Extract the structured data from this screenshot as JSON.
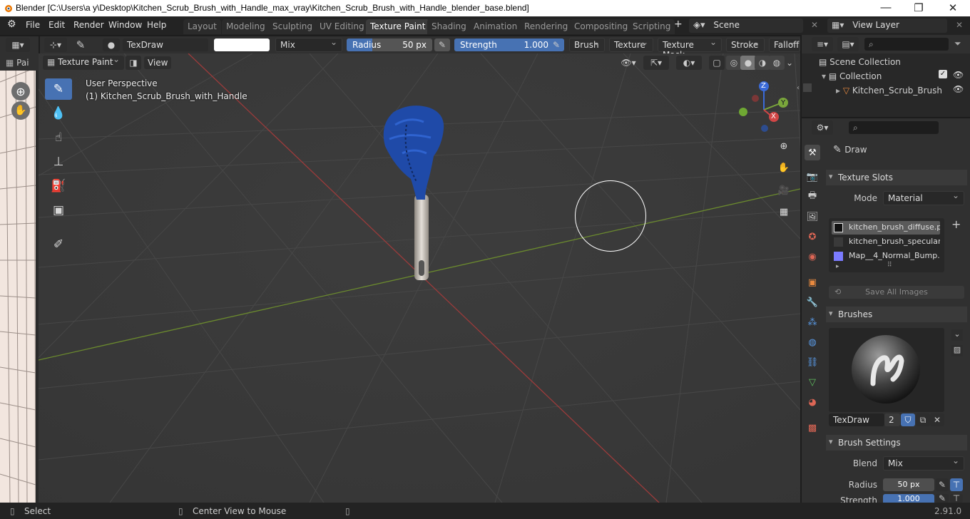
{
  "window": {
    "title": "Blender [C:\\Users\\a y\\Desktop\\Kitchen_Scrub_Brush_with_Handle_max_vray\\Kitchen_Scrub_Brush_with_Handle_blender_base.blend]",
    "minimize": "—",
    "maximize": "❐",
    "close": "✕"
  },
  "menubar": {
    "menus": [
      "File",
      "Edit",
      "Render",
      "Window",
      "Help"
    ],
    "workspaces": [
      "Layout",
      "Modeling",
      "Sculpting",
      "UV Editing",
      "Texture Paint",
      "Shading",
      "Animation",
      "Rendering",
      "Compositing",
      "Scripting"
    ],
    "active_workspace": "Texture Paint",
    "add_tab": "+",
    "scene": "Scene",
    "view_layer": "View Layer"
  },
  "tool_header": {
    "brush_name": "TexDraw",
    "blend_mode": "Mix",
    "radius_label": "Radius",
    "radius_value": "50 px",
    "strength_label": "Strength",
    "strength_value": "1.000",
    "strength_fraction": 1.0,
    "radius_fraction": 0.3,
    "menus": [
      "Brush",
      "Texture",
      "Texture Mask",
      "Stroke",
      "Falloff"
    ]
  },
  "viewport_header": {
    "mode": "Texture Paint",
    "view_menu": "View"
  },
  "viewport": {
    "perspective": "User Perspective",
    "object_label": "(1) Kitchen_Scrub_Brush_with_Handle",
    "gizmo_axes": {
      "x": "X",
      "y": "Y",
      "z": "Z"
    }
  },
  "left_strip": {
    "tab": "Pai"
  },
  "outliner": {
    "items": [
      {
        "label": "Scene Collection"
      },
      {
        "label": "Collection"
      },
      {
        "label": "Kitchen_Scrub_Brush"
      }
    ]
  },
  "properties": {
    "active_tool": "Draw",
    "texture_slots": {
      "title": "Texture Slots",
      "mode_label": "Mode",
      "mode_value": "Material",
      "slots": [
        {
          "name": "kitchen_brush_diffuse.p...",
          "color": "#1b1b1b"
        },
        {
          "name": "kitchen_brush_specular...",
          "color": "#3a3a3a"
        },
        {
          "name": "Map__4_Normal_Bump....",
          "color": "#7b7bff"
        }
      ],
      "save_all": "Save All Images"
    },
    "brushes": {
      "title": "Brushes",
      "brush_name": "TexDraw",
      "users": "2"
    },
    "brush_settings": {
      "title": "Brush Settings",
      "blend_label": "Blend",
      "blend_value": "Mix",
      "radius_label": "Radius",
      "radius_value": "50 px",
      "strength_label": "Strength",
      "strength_value": "1.000"
    }
  },
  "statusbar": {
    "select": "Select",
    "center_view": "Center View to Mouse",
    "version": "2.91.0"
  },
  "colors": {
    "accent": "#4772b3",
    "brush_head": "#1f4aa8",
    "handle": "#bdb8b0",
    "x_axis": "#c4443f",
    "y_axis": "#7aa63b"
  }
}
